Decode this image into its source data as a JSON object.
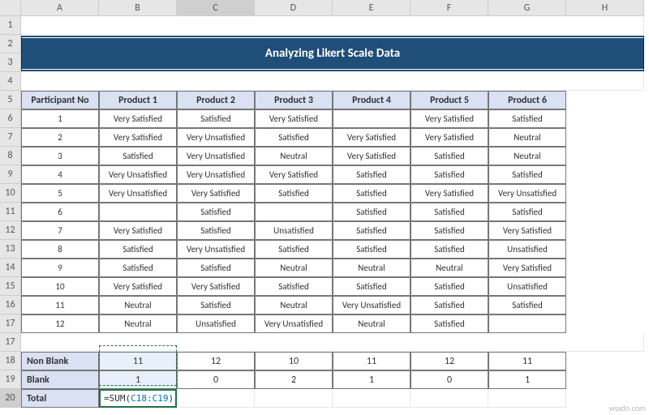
{
  "columns": [
    "A",
    "B",
    "C",
    "D",
    "E",
    "F",
    "G",
    "H"
  ],
  "rows": [
    "1",
    "2",
    "3",
    "4",
    "5",
    "6",
    "7",
    "8",
    "9",
    "10",
    "11",
    "12",
    "13",
    "14",
    "15",
    "16",
    "17",
    "18",
    "19",
    "20"
  ],
  "banner": "Analyzing Likert Scale Data",
  "headers": [
    "Participant No",
    "Product 1",
    "Product 2",
    "Product 3",
    "Product 4",
    "Product 5",
    "Product 6"
  ],
  "table": [
    [
      "1",
      "Very Satisfied",
      "Satisfied",
      "Very Satisfied",
      "",
      "Very Satisfied",
      "Satisfied"
    ],
    [
      "2",
      "Very Satisfied",
      "Very Unsatisfied",
      "Satisfied",
      "Very Satisfied",
      "Very Satisfied",
      "Neutral"
    ],
    [
      "3",
      "Satisfied",
      "Very Unsatisfied",
      "Neutral",
      "Very Satisfied",
      "Satisfied",
      "Neutral"
    ],
    [
      "4",
      "Very Unsatisfied",
      "Very Unsatisfied",
      "Very Satisfied",
      "Satisfied",
      "Satisfied",
      "Satisfied"
    ],
    [
      "5",
      "Very Unsatisfied",
      "Very Satisfied",
      "Satisfied",
      "Satisfied",
      "Very Satisfied",
      "Very Unsatisfied"
    ],
    [
      "6",
      "",
      "Satisfied",
      "",
      "Satisfied",
      "Satisfied",
      "Satisfied"
    ],
    [
      "7",
      "Very Satisfied",
      "Satisfied",
      "Unsatisfied",
      "Satisfied",
      "Satisfied",
      "Very Satisfied"
    ],
    [
      "8",
      "Satisfied",
      "Very Unsatisfied",
      "Satisfied",
      "Satisfied",
      "Satisfied",
      "Unsatisfied"
    ],
    [
      "9",
      "Satisfied",
      "Satisfied",
      "Neutral",
      "Neutral",
      "Neutral",
      "Very Satisfied"
    ],
    [
      "10",
      "Very Satisfied",
      "Very Satisfied",
      "Satisfied",
      "Satisfied",
      "Satisfied",
      "Unsatisfied"
    ],
    [
      "11",
      "Neutral",
      "Satisfied",
      "Neutral",
      "Very Unsatisfied",
      "Satisfied",
      "Satisfied"
    ],
    [
      "12",
      "Neutral",
      "Unsatisfied",
      "Very Unsatisfied",
      "Neutral",
      "Satisfied",
      ""
    ]
  ],
  "summary": {
    "nonblank_label": "Non Blank",
    "blank_label": "Blank",
    "total_label": "Total",
    "nonblank": [
      "11",
      "12",
      "10",
      "11",
      "12",
      "11"
    ],
    "blank": [
      "1",
      "0",
      "2",
      "1",
      "0",
      "1"
    ]
  },
  "formula": {
    "prefix": "=SUM(",
    "ref": "C18:C19",
    "suffix": ")"
  },
  "watermark": "wsxdn.com",
  "active_cell": "C20",
  "marquee_range": "C18:C19"
}
